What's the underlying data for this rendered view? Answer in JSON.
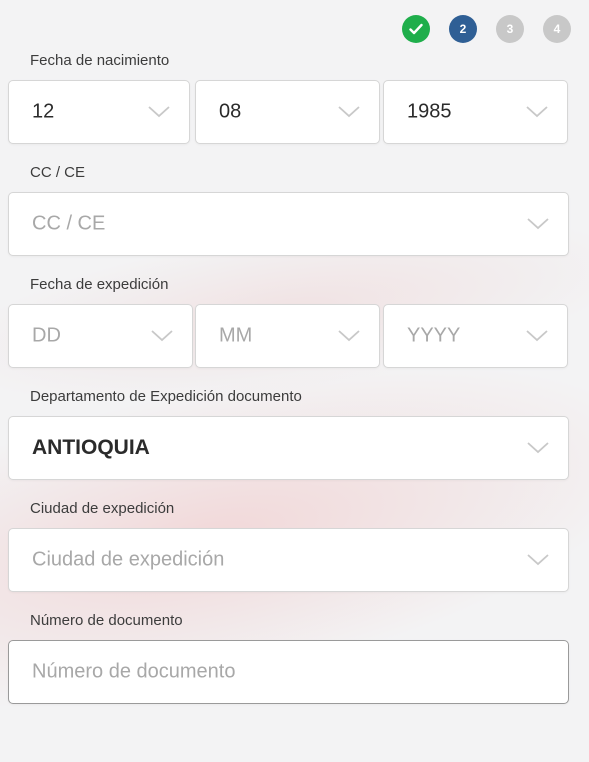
{
  "steps": [
    {
      "label": "✓",
      "state": "complete",
      "color": "#1fae4b"
    },
    {
      "label": "2",
      "state": "current",
      "color": "#2f5f95"
    },
    {
      "label": "3",
      "state": "pending",
      "color": "#c8c8c8"
    },
    {
      "label": "4",
      "state": "pending",
      "color": "#c8c8c8"
    }
  ],
  "birth_date": {
    "label": "Fecha de nacimiento",
    "day": "12",
    "month": "08",
    "year": "1985"
  },
  "doc_type": {
    "label": "CC / CE",
    "placeholder": "CC / CE"
  },
  "expedition_date": {
    "label": "Fecha de expedición",
    "day_placeholder": "DD",
    "month_placeholder": "MM",
    "year_placeholder": "YYYY"
  },
  "department": {
    "label": "Departamento de Expedición documento",
    "value": "ANTIOQUIA"
  },
  "city": {
    "label": "Ciudad de expedición",
    "placeholder": "Ciudad de expedición"
  },
  "doc_number": {
    "label": "Número de documento",
    "placeholder": "Número de documento"
  }
}
